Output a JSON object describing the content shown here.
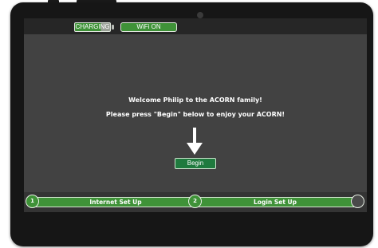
{
  "status": {
    "charging_label": "CHARGING",
    "wifi_label": "WiFi ON"
  },
  "welcome": {
    "line1": "Welcome Philip to the ACORN family!",
    "line2": "Please press \"Begin\" below to enjoy your ACORN!",
    "arrow_icon": "down-arrow-icon",
    "begin_label": "Begin"
  },
  "steps": [
    {
      "number": "1",
      "label": "Internet Set Up"
    },
    {
      "number": "2",
      "label": "Login Set Up"
    }
  ],
  "colors": {
    "accent_green": "#3f9238",
    "button_green": "#1f7a3e",
    "background": "#424242"
  }
}
